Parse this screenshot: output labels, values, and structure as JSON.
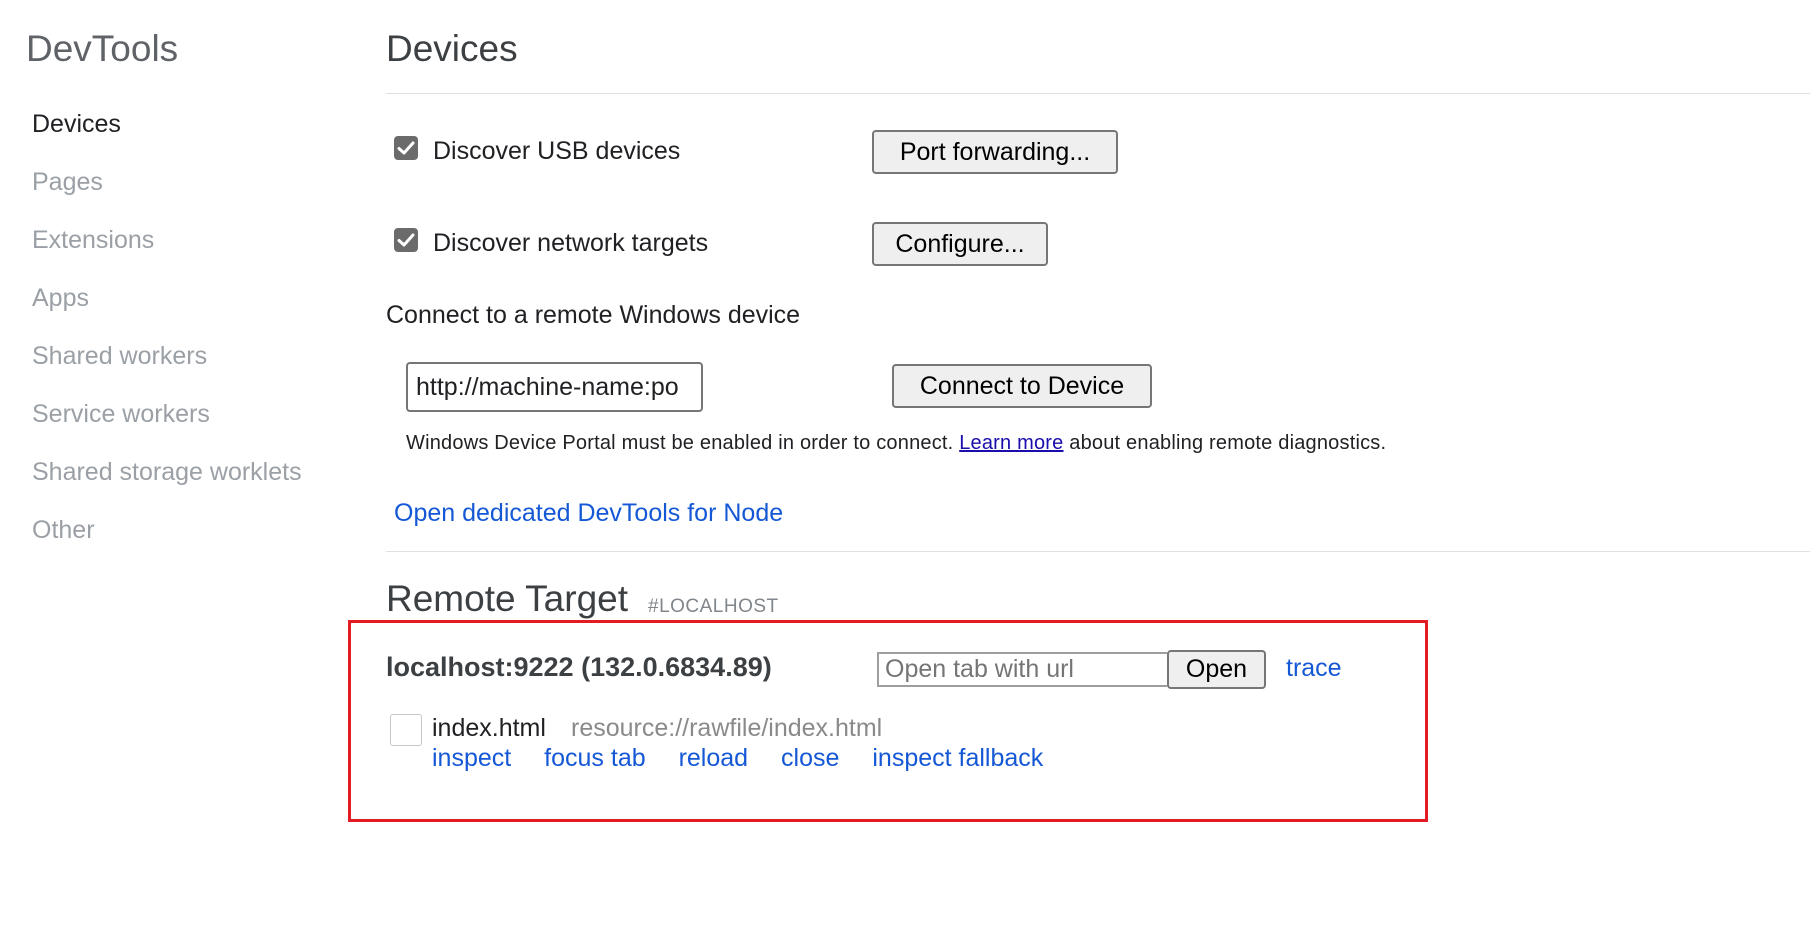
{
  "app": {
    "title": "DevTools"
  },
  "sidebar": {
    "items": [
      {
        "label": "Devices"
      },
      {
        "label": "Pages"
      },
      {
        "label": "Extensions"
      },
      {
        "label": "Apps"
      },
      {
        "label": "Shared workers"
      },
      {
        "label": "Service workers"
      },
      {
        "label": "Shared storage worklets"
      },
      {
        "label": "Other"
      }
    ],
    "active": "Devices"
  },
  "devices": {
    "title": "Devices",
    "usb": {
      "label": "Discover USB devices",
      "checked": true,
      "button": "Port forwarding..."
    },
    "network": {
      "label": "Discover network targets",
      "checked": true,
      "button": "Configure..."
    },
    "remote_windows": {
      "heading": "Connect to a remote Windows device",
      "input_value": "http://machine-name:po",
      "button": "Connect to Device",
      "note_before": "Windows Device Portal must be enabled in order to connect.",
      "note_link": "Learn more",
      "note_after": "about enabling remote diagnostics."
    },
    "node_link": "Open dedicated DevTools for Node"
  },
  "remote_target": {
    "title": "Remote Target",
    "tag": "#LOCALHOST",
    "target_name": "localhost:9222 (132.0.6834.89)",
    "open_tab": {
      "placeholder": "Open tab with url",
      "button": "Open"
    },
    "trace_link": "trace",
    "page": {
      "name": "index.html",
      "url": "resource://rawfile/index.html",
      "actions": [
        "inspect",
        "focus tab",
        "reload",
        "close",
        "inspect fallback"
      ]
    }
  },
  "colors": {
    "highlight_border": "#e21b24",
    "link": "#1558d6"
  }
}
